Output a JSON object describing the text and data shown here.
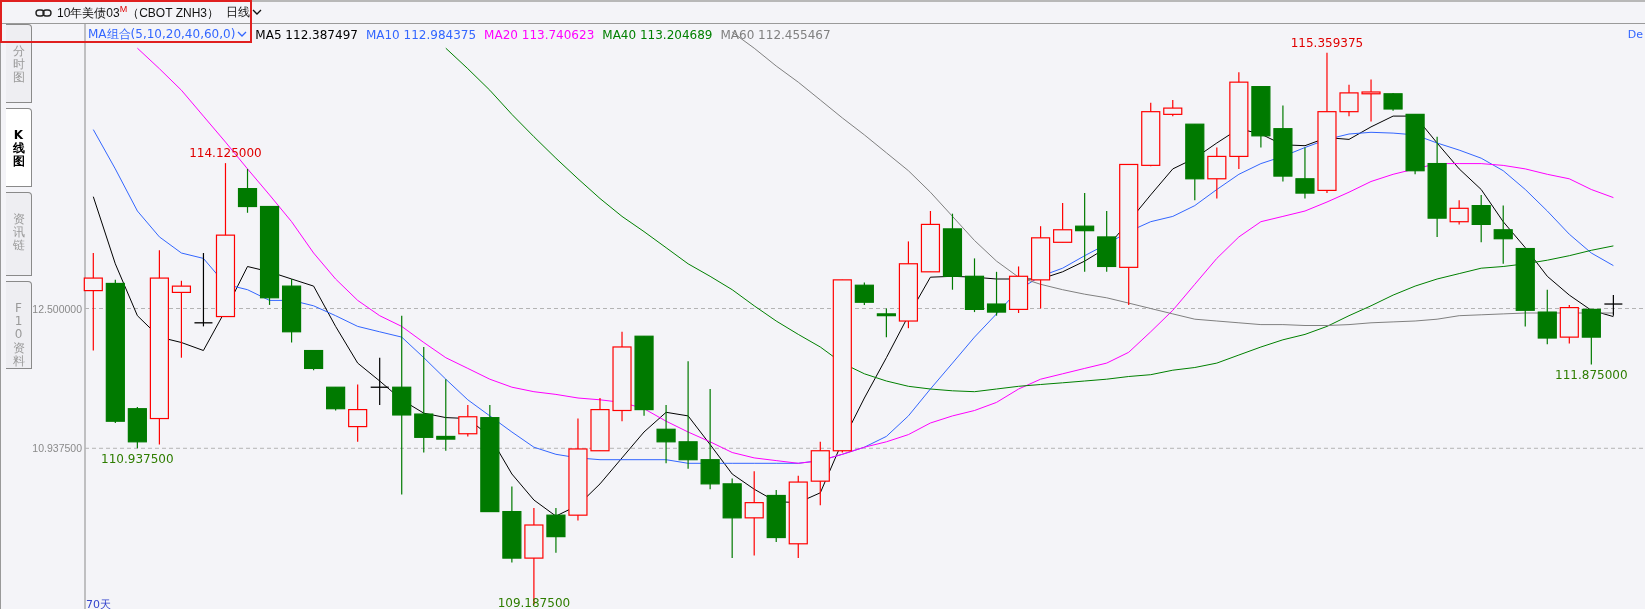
{
  "toolbar": {
    "title": "10年美债03$^{M}$（CBOT ZNH3）",
    "period": "日线"
  },
  "side_tabs": [
    {
      "label": "分时图",
      "selected": false
    },
    {
      "label": "K线图",
      "selected": true
    },
    {
      "label": "资讯链",
      "selected": false
    },
    {
      "label": "F10资料",
      "selected": false
    }
  ],
  "chart": {
    "indicator_selector": "MA组合(5,10,20,40,60,0)",
    "ma_labels": [
      {
        "name": "MA5",
        "value": "112.387497",
        "color": "#000000"
      },
      {
        "name": "MA10",
        "value": "112.984375",
        "color": "#3366ff"
      },
      {
        "name": "MA20",
        "value": "113.740623",
        "color": "#ff00ff"
      },
      {
        "name": "MA40",
        "value": "113.204689",
        "color": "#008000"
      },
      {
        "name": "MA60",
        "value": "112.455467",
        "color": "#808080"
      }
    ],
    "corner_text": "De",
    "axis_labels": [
      "12.500000",
      "10.937500"
    ],
    "price_labels": [
      {
        "text": "114.125000",
        "kind": "high"
      },
      {
        "text": "110.937500",
        "kind": "low"
      },
      {
        "text": "109.187500",
        "kind": "low"
      },
      {
        "text": "115.359375",
        "kind": "high"
      },
      {
        "text": "111.875000",
        "kind": "low"
      }
    ],
    "period_label": "70天"
  }
}
